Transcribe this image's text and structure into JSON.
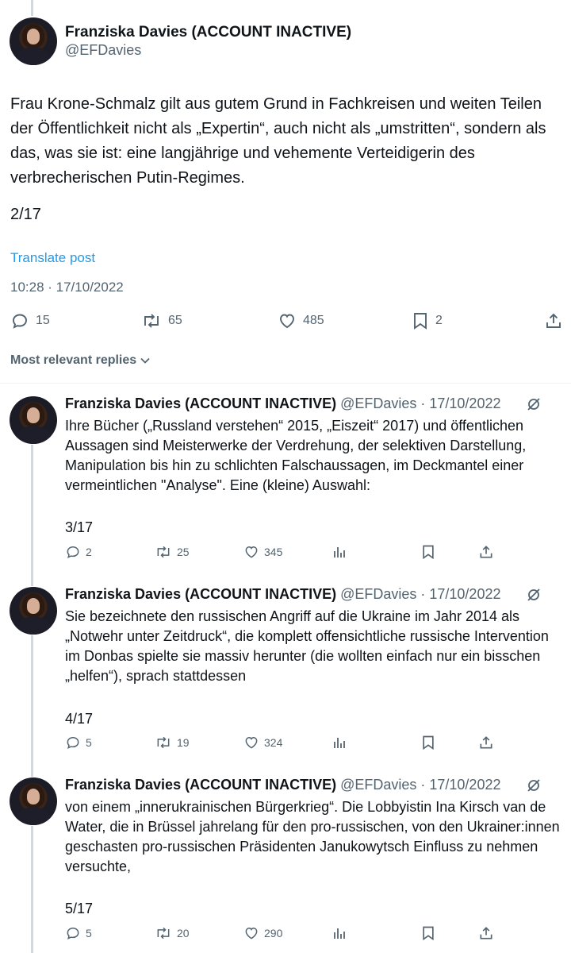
{
  "main_post": {
    "author_name": "Franziska Davies (ACCOUNT INACTIVE)",
    "handle": "@EFDavies",
    "text": "Frau Krone-Schmalz gilt aus gutem Grund in Fachkreisen und weiten Teilen der Öffentlichkeit nicht als „Expertin“, auch nicht als „umstritten“, sondern als das, was sie ist: eine langjährige und vehemente Verteidigerin des verbrecherischen Putin-Regimes.",
    "counter": "2/17",
    "translate_label": "Translate post",
    "timestamp": "10:28 · 17/10/2022",
    "replies": "15",
    "reposts": "65",
    "likes": "485",
    "bookmarks": "2"
  },
  "replies_sort_label": "Most relevant replies",
  "replies": [
    {
      "author_name": "Franziska Davies (ACCOUNT INACTIVE)",
      "handle_date": "@EFDavies · 17/10/2022",
      "text": "Ihre Bücher („Russland verstehen“ 2015, „Eiszeit“ 2017) und öffentlichen Aussagen sind Meisterwerke der Verdrehung, der selektiven Darstellung, Manipulation bis hin zu schlichten Falschaussagen, im Deckmantel einer vermeintlichen \"Analyse\". Eine (kleine) Auswahl:",
      "counter": "3/17",
      "replies": "2",
      "reposts": "25",
      "likes": "345"
    },
    {
      "author_name": "Franziska Davies (ACCOUNT INACTIVE)",
      "handle_date": "@EFDavies · 17/10/2022",
      "text": "Sie bezeichnete den russischen Angriff auf die Ukraine im Jahr 2014 als „Notwehr unter Zeitdruck“, die komplett offensichtliche russische Intervention im Donbas spielte sie massiv herunter (die wollten einfach nur ein bisschen „helfen“), sprach stattdessen",
      "counter": "4/17",
      "replies": "5",
      "reposts": "19",
      "likes": "324"
    },
    {
      "author_name": "Franziska Davies (ACCOUNT INACTIVE)",
      "handle_date": "@EFDavies · 17/10/2022",
      "text": "von einem „innerukrainischen Bürgerkrieg“. Die Lobbyistin Ina Kirsch van de Water, die in Brüssel jahrelang für den pro-russischen, von den Ukrainer:innen geschasten pro-russischen Präsidenten Janukowytsch Einfluss zu nehmen versuchte,",
      "counter": "5/17",
      "replies": "5",
      "reposts": "20",
      "likes": "290"
    }
  ],
  "icons": [
    "reply-icon",
    "repost-icon",
    "like-icon",
    "bookmark-icon",
    "share-icon",
    "views-icon",
    "grok-icon",
    "chevron-down-icon"
  ],
  "colors": {
    "link": "#1d9bf0",
    "secondary": "#536471",
    "text": "#0f1419",
    "thread_line": "#cfd9de"
  }
}
